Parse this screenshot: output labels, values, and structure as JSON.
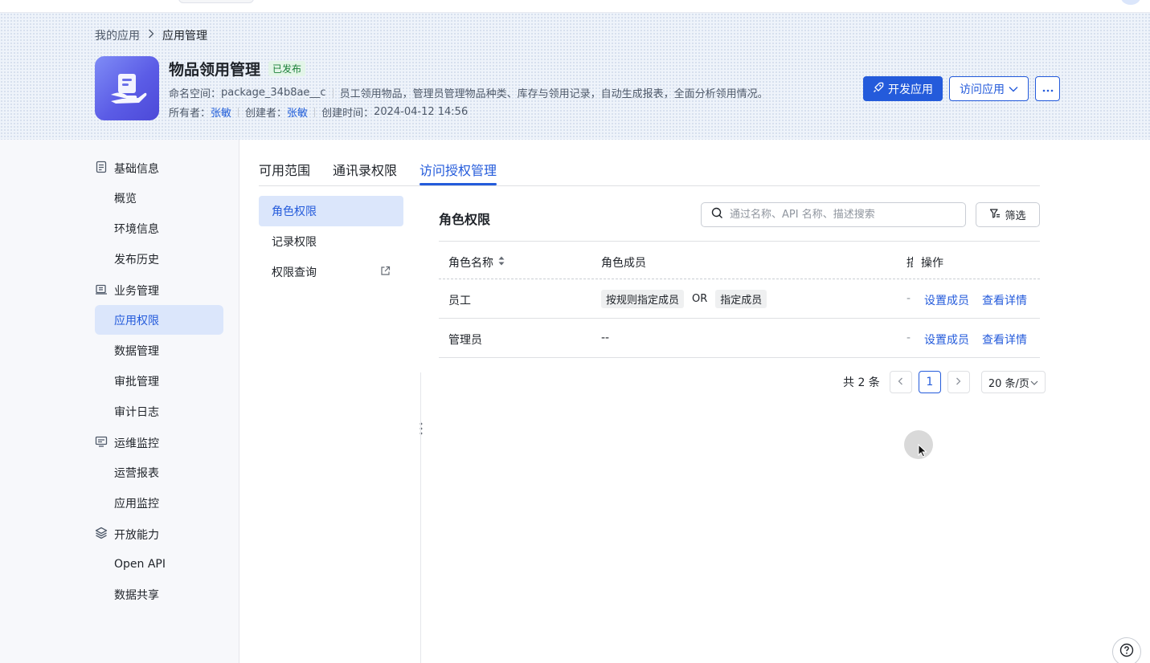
{
  "breadcrumb": {
    "root": "我的应用",
    "current": "应用管理"
  },
  "app": {
    "title": "物品领用管理",
    "status": "已发布",
    "namespace_label": "命名空间：",
    "namespace": "package_34b8ae__c",
    "description": "员工领用物品，管理员管理物品种类、库存与领用记录，自动生成报表，全面分析领用情况。",
    "owner_label": "所有者：",
    "owner": "张敏",
    "creator_label": "创建者：",
    "creator": "张敏",
    "created_label": "创建时间：",
    "created_time": "2024-04-12 14:56"
  },
  "header_actions": {
    "develop": "开发应用",
    "visit": "访问应用"
  },
  "sidebar": {
    "groups": [
      {
        "label": "基础信息",
        "icon": "document-icon",
        "items": [
          "概览",
          "环境信息",
          "发布历史"
        ]
      },
      {
        "label": "业务管理",
        "icon": "briefcase-icon",
        "items": [
          "应用权限",
          "数据管理",
          "审批管理",
          "审计日志"
        ]
      },
      {
        "label": "运维监控",
        "icon": "monitor-icon",
        "items": [
          "运营报表",
          "应用监控"
        ]
      },
      {
        "label": "开放能力",
        "icon": "layers-icon",
        "items": [
          "Open API",
          "数据共享"
        ]
      }
    ],
    "active_item": "应用权限"
  },
  "tabs": [
    "可用范围",
    "通讯录权限",
    "访问授权管理"
  ],
  "active_tab": "访问授权管理",
  "subnav": [
    "角色权限",
    "记录权限",
    "权限查询"
  ],
  "panel": {
    "title": "角色权限",
    "search_placeholder": "通过名称、API 名称、描述搜索",
    "filter_label": "筛选"
  },
  "table": {
    "headers": [
      "角色名称",
      "角色成员",
      "描",
      "操作"
    ],
    "rows": [
      {
        "name": "员工",
        "members": {
          "tag1": "按规则指定成员",
          "joiner": "OR",
          "tag2": "指定成员"
        },
        "description": "-",
        "actions": [
          "设置成员",
          "查看详情"
        ]
      },
      {
        "name": "管理员",
        "members_text": "--",
        "description": "-",
        "actions": [
          "设置成员",
          "查看详情"
        ]
      }
    ]
  },
  "pagination": {
    "total": "共 2 条",
    "current_page": "1",
    "page_size": "20 条/页"
  },
  "colors": {
    "primary": "#245bdb",
    "active_bg": "#dbe6fb",
    "status_green": "#1a7f37"
  }
}
